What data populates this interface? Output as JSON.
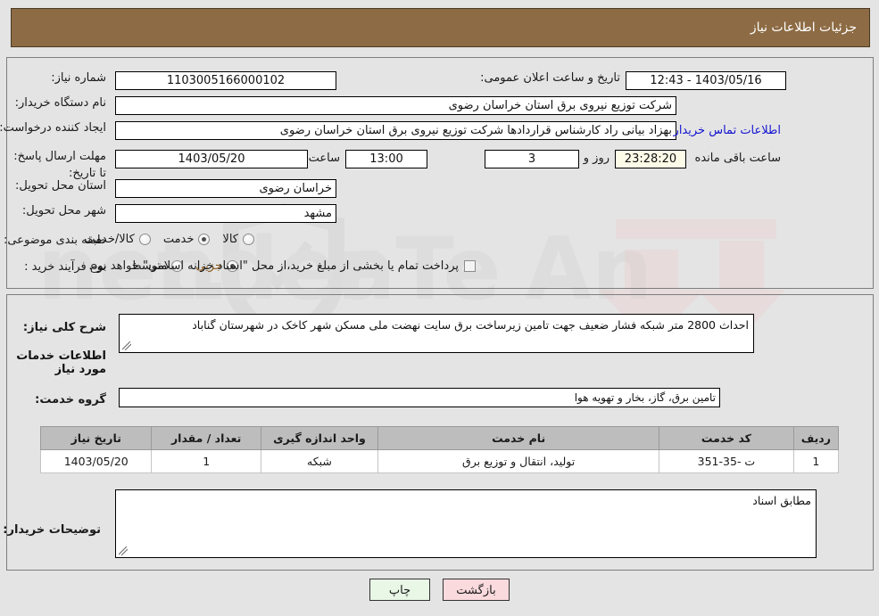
{
  "header": {
    "title": "جزئیات اطلاعات نیاز"
  },
  "form": {
    "need_number_label": "شماره نیاز:",
    "need_number_value": "1103005166000102",
    "announce_datetime_label": "تاریخ و ساعت اعلان عمومی:",
    "announce_datetime_value": "1403/05/16 - 12:43",
    "buyer_org_label": "نام دستگاه خریدار:",
    "buyer_org_value": "شرکت توزیع نیروی برق استان خراسان رضوی",
    "requester_label": "ایجاد کننده درخواست:",
    "requester_value": "بهزاد بیانی راد کارشناس قراردادها شرکت توزیع نیروی برق استان خراسان رضوی",
    "buyer_contact_link": "اطلاعات تماس خریدار",
    "deadline_label": "مهلت ارسال پاسخ: تا تاریخ:",
    "deadline_date": "1403/05/20",
    "deadline_hour_label": "ساعت",
    "deadline_hour": "13:00",
    "remaining_days": "3",
    "remaining_days_label": "روز و",
    "remaining_time": "23:28:20",
    "remaining_time_label": "ساعت باقی مانده",
    "province_label": "استان محل تحویل:",
    "province_value": "خراسان رضوی",
    "city_label": "شهر محل تحویل:",
    "city_value": "مشهد",
    "category_label": "طبقه بندی موضوعی:",
    "category_options": [
      {
        "label": "کالا",
        "selected": false
      },
      {
        "label": "خدمت",
        "selected": true
      },
      {
        "label": "کالا/خدمت",
        "selected": false
      }
    ],
    "purchase_type_label": "نوع فرآیند خرید :",
    "purchase_type_options": [
      {
        "label": "جزیی",
        "selected": true
      },
      {
        "label": "متوسط",
        "selected": false
      }
    ],
    "treasury_checkbox_label": "پرداخت تمام یا بخشی از مبلغ خرید،از محل \"اسناد خزانه اسلامی\" خواهد بود.",
    "treasury_checked": false
  },
  "description": {
    "label": "شرح کلی نیاز:",
    "value": "احداث 2800 متر شبکه فشار ضعیف جهت تامین زیرساخت برق  سایت نهضت ملی مسکن شهر کاخک در شهرستان گناباد"
  },
  "services_section": {
    "heading": "اطلاعات خدمات مورد نیاز",
    "group_label": "گروه خدمت:",
    "group_value": "تامین برق، گاز، بخار و تهویه هوا",
    "table": {
      "columns": [
        "ردیف",
        "کد خدمت",
        "نام خدمت",
        "واحد اندازه گیری",
        "تعداد / مقدار",
        "تاریخ نیاز"
      ],
      "rows": [
        [
          "1",
          "ت -35-351",
          "تولید، انتقال و توزیع برق",
          "شبکه",
          "1",
          "1403/05/20"
        ]
      ]
    }
  },
  "buyer_notes": {
    "label": "توضیحات خریدار:",
    "value": "مطابق اسناد"
  },
  "buttons": {
    "print": "چاپ",
    "back": "بازگشت"
  },
  "colors": {
    "header_bg": "#8d6b44",
    "link": "#1414d2",
    "print_bg": "#e8f7e6",
    "back_bg": "#fadadd",
    "table_header_bg": "#bdbdbd"
  }
}
